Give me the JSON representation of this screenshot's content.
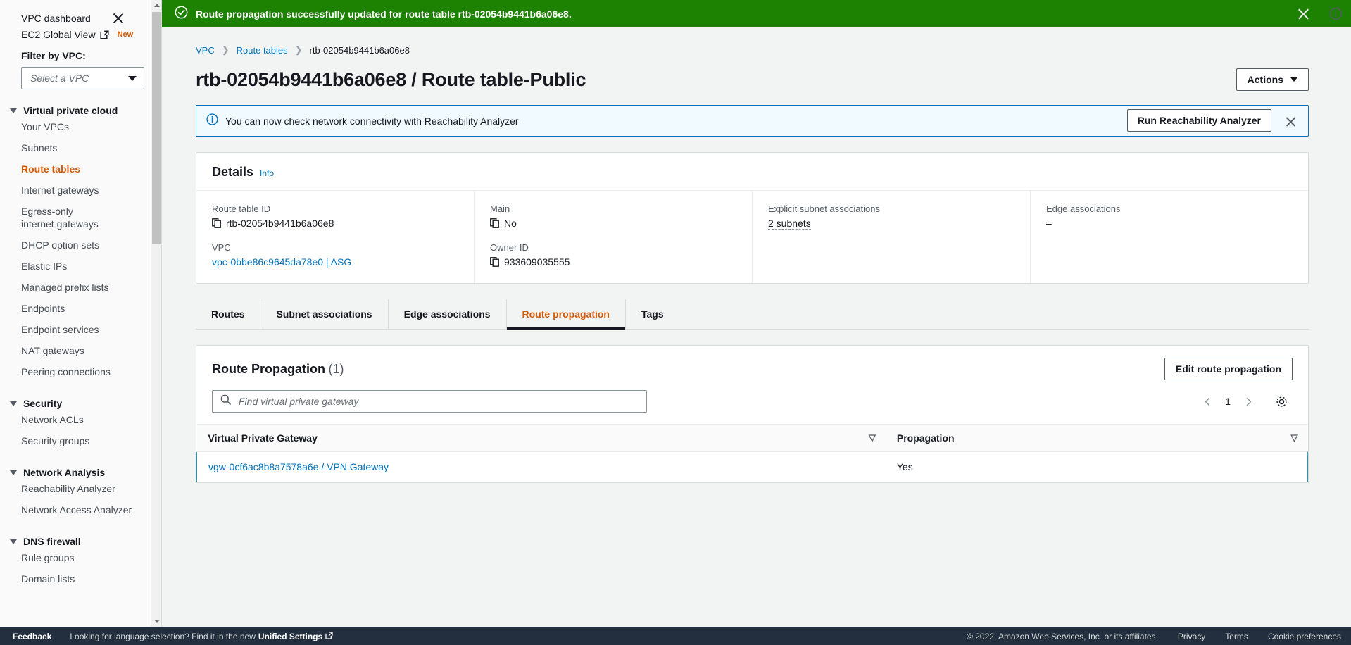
{
  "sidebar": {
    "dashboard_label": "VPC dashboard",
    "global_view_label": "EC2 Global View",
    "global_view_badge": "New",
    "filter_label": "Filter by VPC:",
    "vpc_select_placeholder": "Select a VPC",
    "groups": [
      {
        "title": "Virtual private cloud",
        "items": [
          {
            "label": "Your VPCs",
            "active": false
          },
          {
            "label": "Subnets",
            "active": false
          },
          {
            "label": "Route tables",
            "active": true
          },
          {
            "label": "Internet gateways",
            "active": false
          },
          {
            "label": "Egress-only internet gateways",
            "active": false
          },
          {
            "label": "DHCP option sets",
            "active": false
          },
          {
            "label": "Elastic IPs",
            "active": false
          },
          {
            "label": "Managed prefix lists",
            "active": false
          },
          {
            "label": "Endpoints",
            "active": false
          },
          {
            "label": "Endpoint services",
            "active": false
          },
          {
            "label": "NAT gateways",
            "active": false
          },
          {
            "label": "Peering connections",
            "active": false
          }
        ]
      },
      {
        "title": "Security",
        "items": [
          {
            "label": "Network ACLs",
            "active": false
          },
          {
            "label": "Security groups",
            "active": false
          }
        ]
      },
      {
        "title": "Network Analysis",
        "items": [
          {
            "label": "Reachability Analyzer",
            "active": false
          },
          {
            "label": "Network Access Analyzer",
            "active": false
          }
        ]
      },
      {
        "title": "DNS firewall",
        "items": [
          {
            "label": "Rule groups",
            "active": false
          },
          {
            "label": "Domain lists",
            "active": false
          }
        ]
      }
    ]
  },
  "flash": {
    "message": "Route propagation successfully updated for route table rtb-02054b9441b6a06e8.",
    "background": "#1d8102"
  },
  "breadcrumb": [
    {
      "label": "VPC",
      "link": true
    },
    {
      "label": "Route tables",
      "link": true
    },
    {
      "label": "rtb-02054b9441b6a06e8",
      "link": false
    }
  ],
  "header": {
    "title": "rtb-02054b9441b6a06e8 / Route table-Public",
    "actions_label": "Actions"
  },
  "alert": {
    "text": "You can now check network connectivity with Reachability Analyzer",
    "button_label": "Run Reachability Analyzer",
    "accent": "#0073bb"
  },
  "details": {
    "title": "Details",
    "info_label": "Info",
    "fields": {
      "route_table_id_label": "Route table ID",
      "route_table_id_value": "rtb-02054b9441b6a06e8",
      "vpc_label": "VPC",
      "vpc_value": "vpc-0bbe86c9645da78e0 | ASG",
      "main_label": "Main",
      "main_value": "No",
      "owner_id_label": "Owner ID",
      "owner_id_value": "933609035555",
      "explicit_subnet_label": "Explicit subnet associations",
      "explicit_subnet_value": "2 subnets",
      "edge_assoc_label": "Edge associations",
      "edge_assoc_value": "–"
    }
  },
  "tabs": [
    {
      "label": "Routes",
      "active": false
    },
    {
      "label": "Subnet associations",
      "active": false
    },
    {
      "label": "Edge associations",
      "active": false
    },
    {
      "label": "Route propagation",
      "active": true
    },
    {
      "label": "Tags",
      "active": false
    }
  ],
  "propagation_panel": {
    "title": "Route Propagation",
    "count": "(1)",
    "edit_button_label": "Edit route propagation",
    "search_placeholder": "Find virtual private gateway",
    "search_value": "",
    "page_number": "1",
    "columns": [
      "Virtual Private Gateway",
      "Propagation"
    ],
    "rows": [
      {
        "gateway": "vgw-0cf6ac8b8a7578a6e / VPN Gateway",
        "propagation": "Yes",
        "selected": true
      }
    ]
  },
  "footer": {
    "feedback_label": "Feedback",
    "language_text": "Looking for language selection? Find it in the new",
    "unified_settings_label": "Unified Settings",
    "copyright": "© 2022, Amazon Web Services, Inc. or its affiliates.",
    "links": [
      "Privacy",
      "Terms",
      "Cookie preferences"
    ]
  },
  "colors": {
    "accent_orange": "#d45b07",
    "link_blue": "#0073bb",
    "success_green": "#1d8102",
    "footer_navy": "#232f3e",
    "selection_teal": "#00a1c9"
  }
}
